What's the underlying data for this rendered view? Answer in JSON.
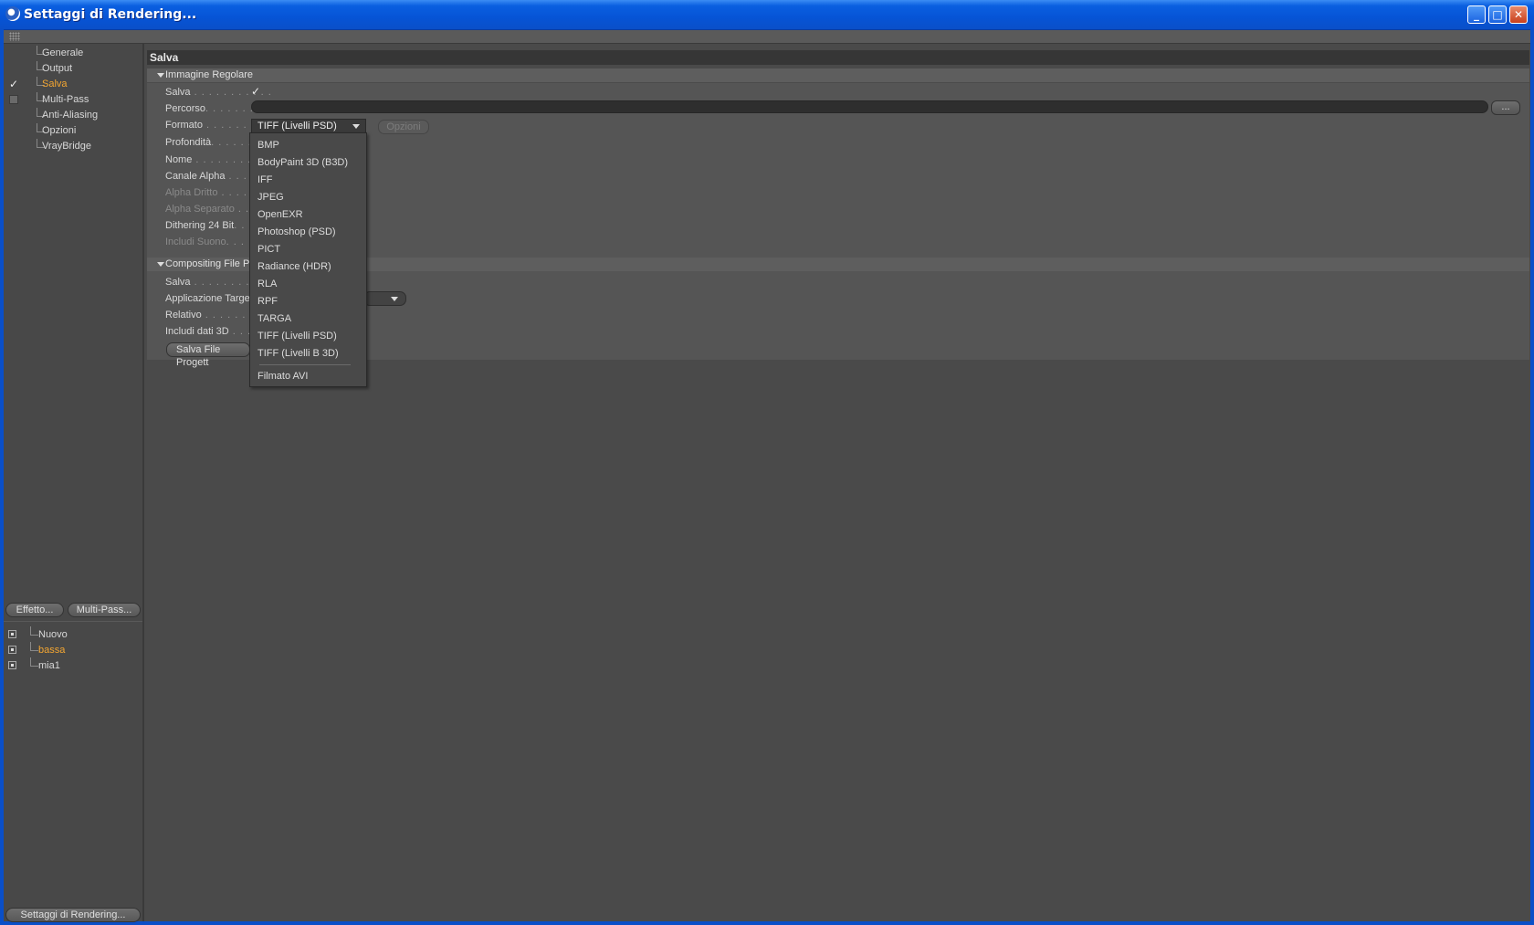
{
  "window": {
    "title": "Settaggi di Rendering...",
    "minimize": "_",
    "maximize": "□",
    "close": "✕"
  },
  "sidebar": {
    "items": [
      {
        "label": "Generale",
        "checked": false,
        "active": false
      },
      {
        "label": "Output",
        "checked": false,
        "active": false
      },
      {
        "label": "Salva",
        "checked": true,
        "active": true
      },
      {
        "label": "Multi-Pass",
        "checked": false,
        "box": true,
        "active": false
      },
      {
        "label": "Anti-Aliasing",
        "checked": false,
        "active": false
      },
      {
        "label": "Opzioni",
        "checked": false,
        "active": false
      },
      {
        "label": "VrayBridge",
        "checked": false,
        "active": false
      }
    ],
    "effect_button": "Effetto...",
    "multipass_button": "Multi-Pass...",
    "render_settings": [
      {
        "label": "Nuovo",
        "active": false
      },
      {
        "label": "bassa",
        "active": true
      },
      {
        "label": "mia1",
        "active": false
      }
    ],
    "bottom_button": "Settaggi di Rendering..."
  },
  "main": {
    "header": "Salva",
    "section1": {
      "title": "Immagine Regolare",
      "rows": [
        {
          "label": "Salva",
          "dots": " . . . . . . . . . . .",
          "dim": false
        },
        {
          "label": "Percorso",
          "dots": ". . . . . . . .",
          "dim": false
        },
        {
          "label": "Formato",
          "dots": " . . . . . . . . .",
          "dim": false
        },
        {
          "label": "Profondità",
          "dots": ". . . . . . .",
          "dim": false
        },
        {
          "label": "Nome",
          "dots": " . . . . . . . . . . .",
          "dim": false
        },
        {
          "label": "Canale Alpha",
          "dots": " . . . . .",
          "dim": false
        },
        {
          "label": "Alpha Dritto",
          "dots": " . . . . .",
          "dim": true
        },
        {
          "label": "Alpha Separato",
          "dots": " . . .",
          "dim": true
        },
        {
          "label": "Dithering 24 Bit",
          "dots": ". . .",
          "dim": false
        },
        {
          "label": "Includi Suono",
          "dots": ". . . . .",
          "dim": true
        }
      ],
      "browse_label": "...",
      "format_value": "TIFF  (Livelli PSD)",
      "options_button": "Opzioni"
    },
    "section2": {
      "title": "Compositing File Pr",
      "rows": [
        {
          "label": "Salva",
          "dots": " . . . . . . . . . . .",
          "dim": false
        },
        {
          "label": "Applicazione Targe",
          "dots": "",
          "dim": false
        },
        {
          "label": "Relativo",
          "dots": " . . . . . . . . .",
          "dim": false
        },
        {
          "label": "Includi dati 3D",
          "dots": " . . . .",
          "dim": false
        }
      ],
      "save_project_button": "Salva File Progett"
    },
    "format_dropdown": {
      "options": [
        "BMP",
        "BodyPaint 3D (B3D)",
        "IFF",
        "JPEG",
        "OpenEXR",
        "Photoshop (PSD)",
        "PICT",
        "Radiance (HDR)",
        "RLA",
        "RPF",
        "TARGA",
        "TIFF  (Livelli PSD)",
        "TIFF  (Livelli  B 3D)"
      ],
      "extra_option": "Filmato AVI"
    }
  },
  "icons": {
    "check": "✓",
    "app": "cinema4d-icon"
  },
  "colors": {
    "title_bar": "#0a5fe0",
    "active_item": "#f3a632",
    "panel_bg": "#4a4a4a"
  }
}
